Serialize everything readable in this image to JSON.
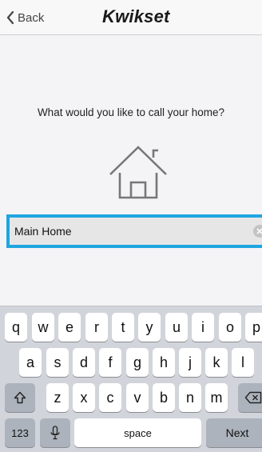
{
  "nav": {
    "back_label": "Back",
    "brand": "Kwikset"
  },
  "prompt": "What would you like to call your home?",
  "home_name": {
    "value": "Main Home"
  },
  "keyboard": {
    "row1": [
      "q",
      "w",
      "e",
      "r",
      "t",
      "y",
      "u",
      "i",
      "o",
      "p"
    ],
    "row2": [
      "a",
      "s",
      "d",
      "f",
      "g",
      "h",
      "j",
      "k",
      "l"
    ],
    "row3": [
      "z",
      "x",
      "c",
      "v",
      "b",
      "n",
      "m"
    ],
    "numbers_label": "123",
    "space_label": "space",
    "next_label": "Next"
  },
  "colors": {
    "accent_border": "#1fa5e0",
    "keyboard_bg": "#d1d4da"
  }
}
